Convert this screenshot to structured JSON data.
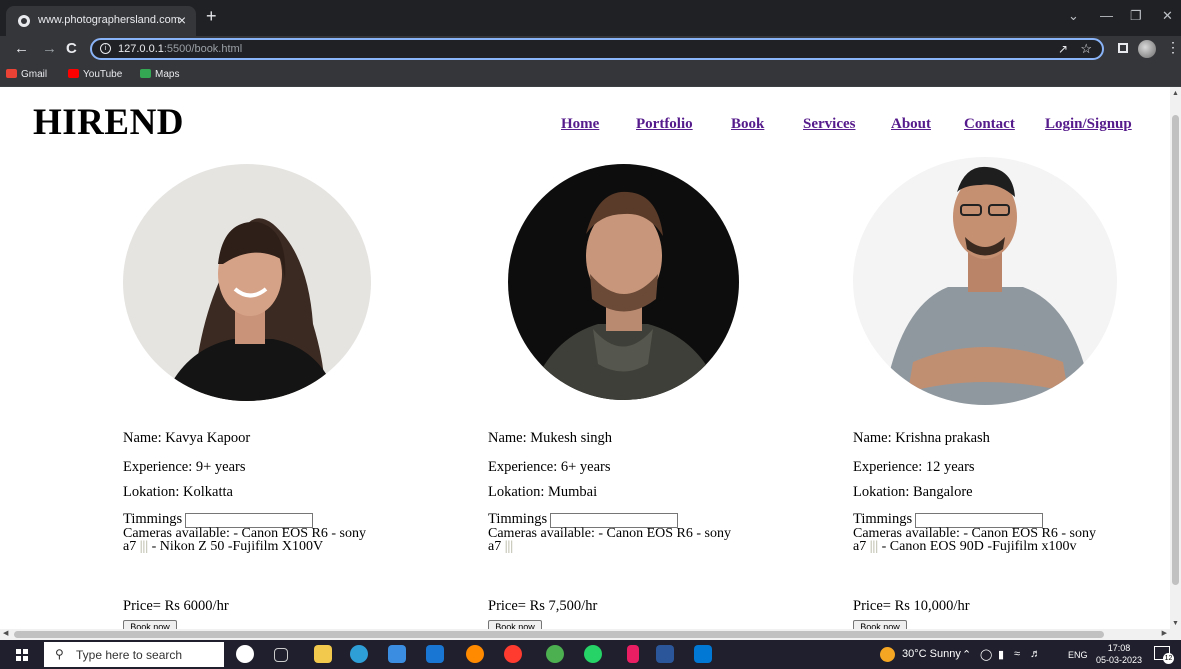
{
  "browser": {
    "tab_title": "www.photographersland.com",
    "tab_close": "×",
    "new_tab": "+",
    "url_host": "127.0.0.1",
    "url_rest": ":5500/book.html",
    "bookmarks": [
      {
        "label": "Gmail",
        "color": "#ea4335"
      },
      {
        "label": "YouTube",
        "color": "#ff0000"
      },
      {
        "label": "Maps",
        "color": "#34a853"
      }
    ]
  },
  "site": {
    "logo": "HIREND",
    "nav": [
      "Home",
      "Portfolio",
      "Book",
      "Services",
      "About",
      "Contact",
      "Login/Signup"
    ]
  },
  "photographers": [
    {
      "name": "Name: Kavya Kapoor",
      "experience": "Experience: 9+ years",
      "location": "Lokation: Kolkatta",
      "timings_label": "Timmings",
      "cameras_prefix": "Cameras available: - Canon EOS R6 - sony a7 ",
      "cameras_bar": "|||",
      "cameras_suffix": " - Nikon Z 50 -Fujifilm X100V",
      "price": "Price= Rs 6000/hr",
      "book_label": "Book now"
    },
    {
      "name": "Name: Mukesh singh",
      "experience": "Experience: 6+ years",
      "location": "Lokation: Mumbai",
      "timings_label": "Timmings",
      "cameras_prefix": "Cameras available: - Canon EOS R6 - sony a7 ",
      "cameras_bar": "|||",
      "cameras_suffix": "",
      "price": "Price= Rs 7,500/hr",
      "book_label": "Book now"
    },
    {
      "name": "Name: Krishna prakash",
      "experience": "Experience: 12 years",
      "location": "Lokation: Bangalore",
      "timings_label": "Timmings",
      "cameras_prefix": "Cameras available: - Canon EOS R6 - sony a7 ",
      "cameras_bar": "|||",
      "cameras_suffix": " - Canon EOS 90D -Fujifilm x100v",
      "price": "Price= Rs 10,000/hr",
      "book_label": "Book now"
    }
  ],
  "taskbar": {
    "search_placeholder": "Type here to search",
    "weather": "30°C  Sunny",
    "language": "ENG",
    "time": "17:08",
    "date": "05-03-2023",
    "notifications": "12"
  }
}
